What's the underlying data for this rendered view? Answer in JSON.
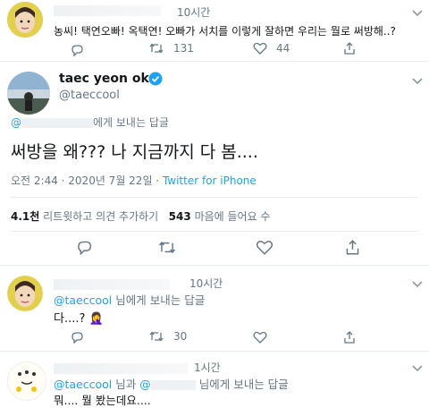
{
  "tweet1": {
    "time": "10시간",
    "text": "농씨! 택연오빠! 옥택연! 오빠가 서치를 이렇게 잘하면 우리는 뭘로 써방해..?",
    "retweets": "131",
    "likes": "44"
  },
  "main": {
    "display_name": "taec yeon ok",
    "handle": "@taeccool",
    "reply_prefix": "@",
    "reply_suffix": "에게 보내는 답글",
    "text": "써방을 왜??? 나 지금까지 다 봄....",
    "timestamp": "오전 2:44 · 2020년 7월 22일",
    "source": "Twitter for iPhone",
    "retweet_count": "4.1천",
    "retweet_label": "리트윗하고 의견 추가하기",
    "like_count": "543",
    "like_label": "마음에 들어요 수"
  },
  "reply1": {
    "time": "10시간",
    "mention": "@taeccool",
    "reply_suffix": "님에게 보내는 답글",
    "text": "다....? 🤦‍♀️",
    "retweets": "30"
  },
  "reply2": {
    "time": "1시간",
    "mention1": "@taeccool",
    "middle": "님과",
    "mention2": "@",
    "reply_suffix": "님에게 보내는 답글",
    "text": "뭐.... 뭘 봤는데요...."
  },
  "colors": {
    "accent": "#1da1f2",
    "muted": "#657786",
    "border": "#e6ecf0"
  }
}
